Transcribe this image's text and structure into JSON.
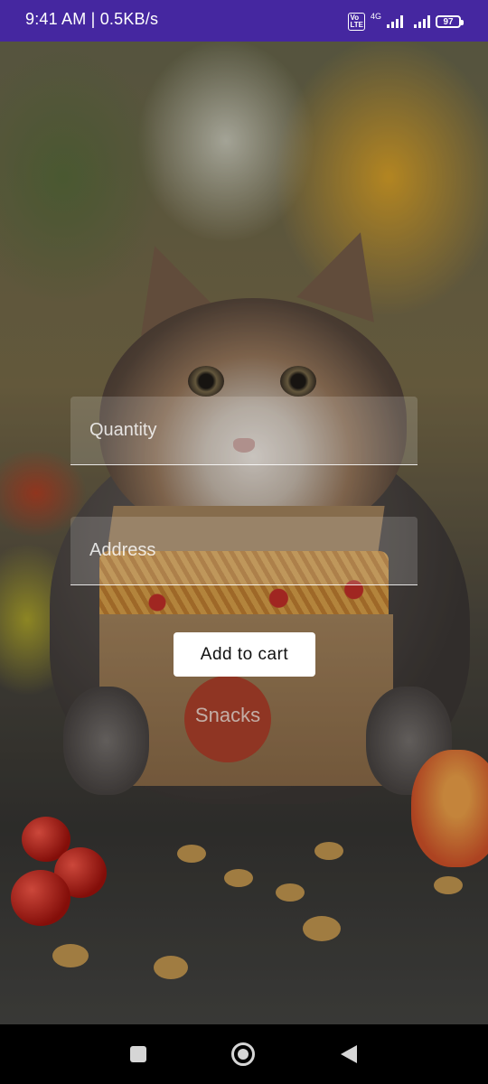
{
  "status_bar": {
    "time_speed": "9:41 AM | 0.5KB/s",
    "volte": "Vo LTE",
    "network": "4G",
    "battery": "97"
  },
  "form": {
    "quantity_placeholder": "Quantity",
    "address_placeholder": "Address",
    "add_to_cart_label": "Add to cart"
  },
  "box_logo": "Snacks",
  "nav_bar": {
    "icons": [
      "square-recents-icon",
      "circle-home-icon",
      "triangle-back-icon"
    ]
  },
  "colors": {
    "status_bar": "#4527a0",
    "button_bg": "#ffffff",
    "nav_bar": "#000000"
  }
}
